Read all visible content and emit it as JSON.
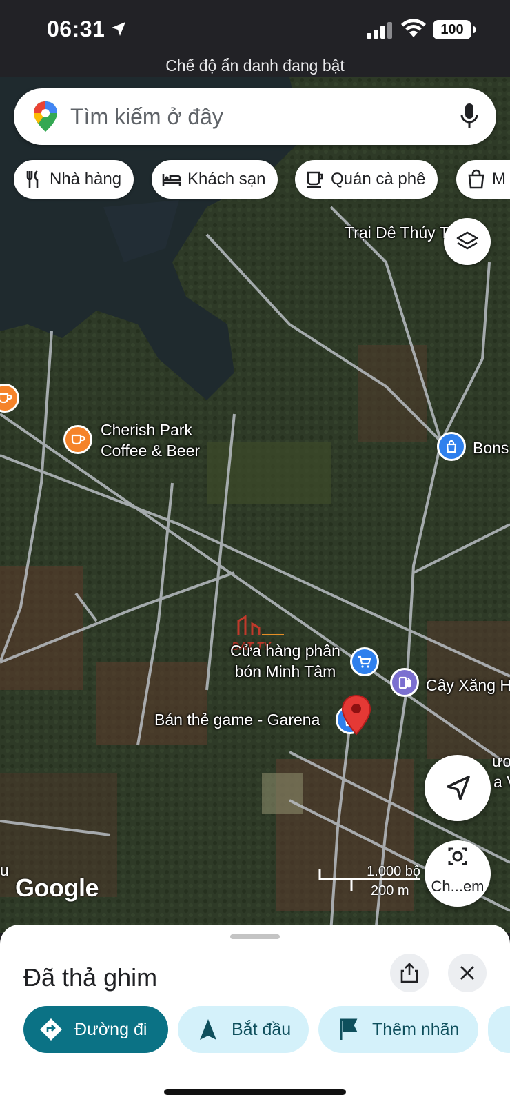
{
  "status_bar": {
    "time": "06:31",
    "battery": "100",
    "incognito_text": "Chế độ ẩn danh đang bật"
  },
  "search": {
    "placeholder": "Tìm kiếm ở đây"
  },
  "chips": [
    {
      "label": "Nhà hàng",
      "icon": "restaurant-icon"
    },
    {
      "label": "Khách sạn",
      "icon": "hotel-icon"
    },
    {
      "label": "Quán cà phê",
      "icon": "coffee-icon"
    },
    {
      "label": "M",
      "icon": "shopping-bag-icon"
    }
  ],
  "map": {
    "labels": {
      "trai_de": "Trại Dê Thúy T",
      "cherish_line1": "Cherish Park",
      "cherish_line2": "Coffee & Beer",
      "bons": "Bons",
      "cua_hang_line1": "Cửa hàng phân",
      "cua_hang_line2": "bón Minh Tâm",
      "cay_xang": "Cây Xăng H",
      "ban_the": "Bán thẻ game - Garena",
      "right_edge1": "ươn",
      "right_edge2": "a Vă",
      "left_edge": "u"
    },
    "watermark": "DAT TY",
    "google_logo": "Google",
    "scale_top": "1.000 bộ",
    "scale_bottom": "200 m",
    "lens_label": "Ch...em",
    "colors": {
      "terrain_dark": "#2b3326",
      "water": "#1f2a2e",
      "road": "#b9bec4",
      "pin": "#e53935",
      "poi_coffee": "#f5832a",
      "poi_shop": "#2f80ed",
      "poi_fuel": "#7b6fd0"
    }
  },
  "sheet": {
    "title": "Đã thả ghim",
    "actions": {
      "directions": "Đường đi",
      "start": "Bắt đầu",
      "label": "Thêm nhãn"
    }
  }
}
